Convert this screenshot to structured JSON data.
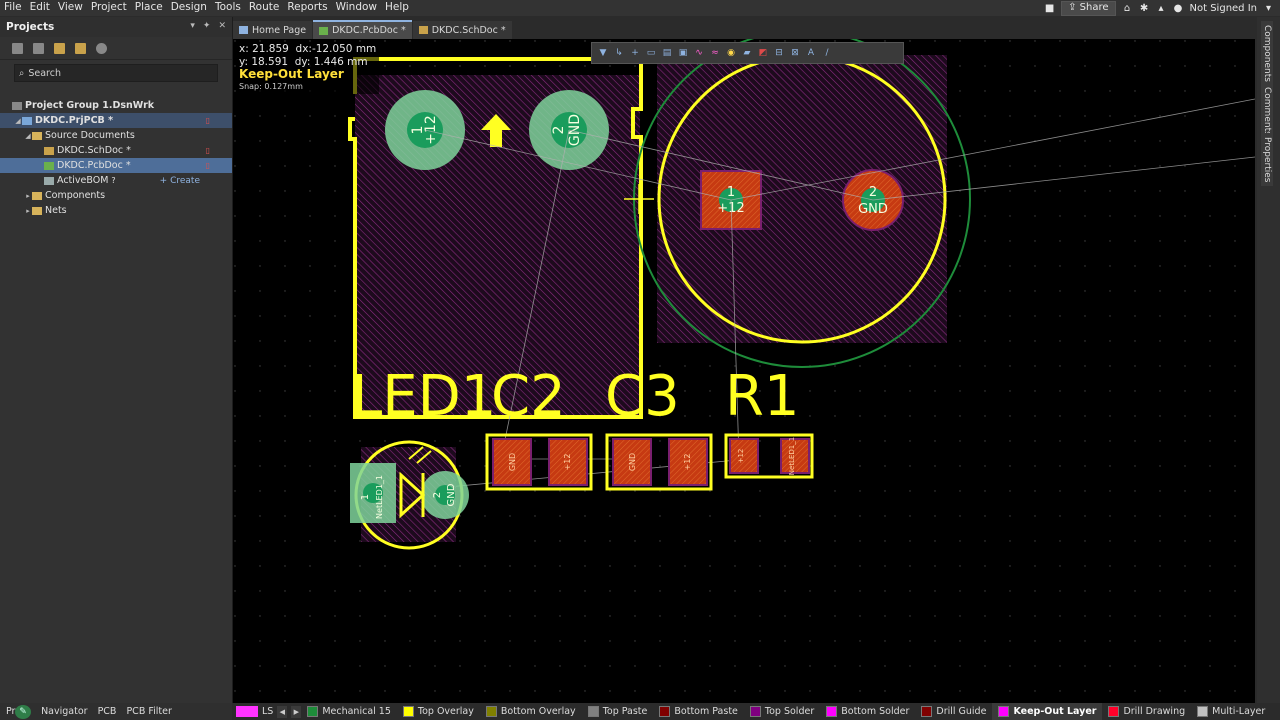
{
  "menu": [
    "File",
    "Edit",
    "View",
    "Project",
    "Place",
    "Design",
    "Tools",
    "Route",
    "Reports",
    "Window",
    "Help"
  ],
  "menubar_right": {
    "share": "Share",
    "signin": "Not Signed In"
  },
  "projects_panel": {
    "title": "Projects",
    "search_placeholder": "Search",
    "tree": [
      {
        "label": "Project Group 1.DsnWrk"
      },
      {
        "label": "DKDC.PrjPCB *"
      },
      {
        "label": "Source Documents"
      },
      {
        "label": "DKDC.SchDoc *"
      },
      {
        "label": "DKDC.PcbDoc *"
      },
      {
        "label": "ActiveBOM"
      },
      {
        "label": "Components"
      },
      {
        "label": "Nets"
      }
    ],
    "create_link": "+ Create"
  },
  "bottom_left": {
    "tab1": "Pro",
    "navigator": "Navigator",
    "pcb": "PCB",
    "pcb_filter": "PCB Filter"
  },
  "doc_tabs": [
    "Home Page",
    "DKDC.PcbDoc *",
    "DKDC.SchDoc *"
  ],
  "hud": {
    "x": "x: 21.859",
    "dx": "dx:-12.050 mm",
    "y": "y: 18.591",
    "dy": "dy:  1.446  mm",
    "layer": "Keep-Out Layer",
    "snap": "Snap: 0.127mm"
  },
  "pcb_labels": {
    "designators": [
      "LED1",
      "C2",
      "C3",
      "R1"
    ]
  },
  "pads": {
    "p1": "1",
    "p12": "+12",
    "p2": "2",
    "gnd": "GND",
    "netled1": "NetLED1_1",
    "np12": "+12",
    "nGND": "GND"
  },
  "right_tabs": [
    "Components",
    "Comments",
    "Properties"
  ],
  "layer_bar": {
    "ls": "LS",
    "layers": [
      {
        "name": "Mechanical 15",
        "color": "#1e8c3a"
      },
      {
        "name": "Top Overlay",
        "color": "#ffff00"
      },
      {
        "name": "Bottom Overlay",
        "color": "#808000"
      },
      {
        "name": "Top Paste",
        "color": "#808080"
      },
      {
        "name": "Bottom Paste",
        "color": "#800000"
      },
      {
        "name": "Top Solder",
        "color": "#800080"
      },
      {
        "name": "Bottom Solder",
        "color": "#ff00ff"
      },
      {
        "name": "Drill Guide",
        "color": "#800000"
      },
      {
        "name": "Keep-Out Layer",
        "color": "#ff00ff"
      },
      {
        "name": "Drill Drawing",
        "color": "#ff002a"
      },
      {
        "name": "Multi-Layer",
        "color": "#c0c0c0"
      }
    ]
  },
  "colors": {
    "overlay": "#ffff22",
    "solder": "#7a1f6e",
    "copper": "#c63a12",
    "pad_green": "#7fd39b",
    "circle_green": "#1e8c3a"
  }
}
